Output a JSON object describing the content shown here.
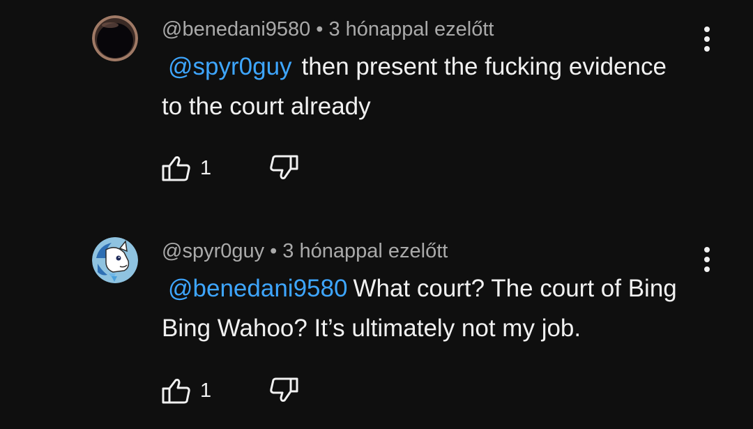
{
  "comments": [
    {
      "author": "@benedani9580",
      "separator": "•",
      "time": "3 hónappal ezelőtt",
      "mention": "@spyr0guy",
      "text": "then present the fucking evidence to the court already",
      "likes": "1",
      "avatar_icon": "dark-circle-avatar",
      "menu_icon": "more-vertical-icon"
    },
    {
      "author": "@spyr0guy",
      "separator": "•",
      "time": "3 hónappal ezelőtt",
      "mention": "@benedani9580",
      "text": "What court? The court of Bing Bing Wahoo? It’s ultimately not my job.",
      "likes": "1",
      "avatar_icon": "cartoon-pony-avatar",
      "menu_icon": "more-vertical-icon"
    }
  ],
  "colors": {
    "background": "#0f0f0f",
    "text": "#f1f1f1",
    "secondary_text": "#aaaaaa",
    "mention": "#3ea6ff"
  }
}
